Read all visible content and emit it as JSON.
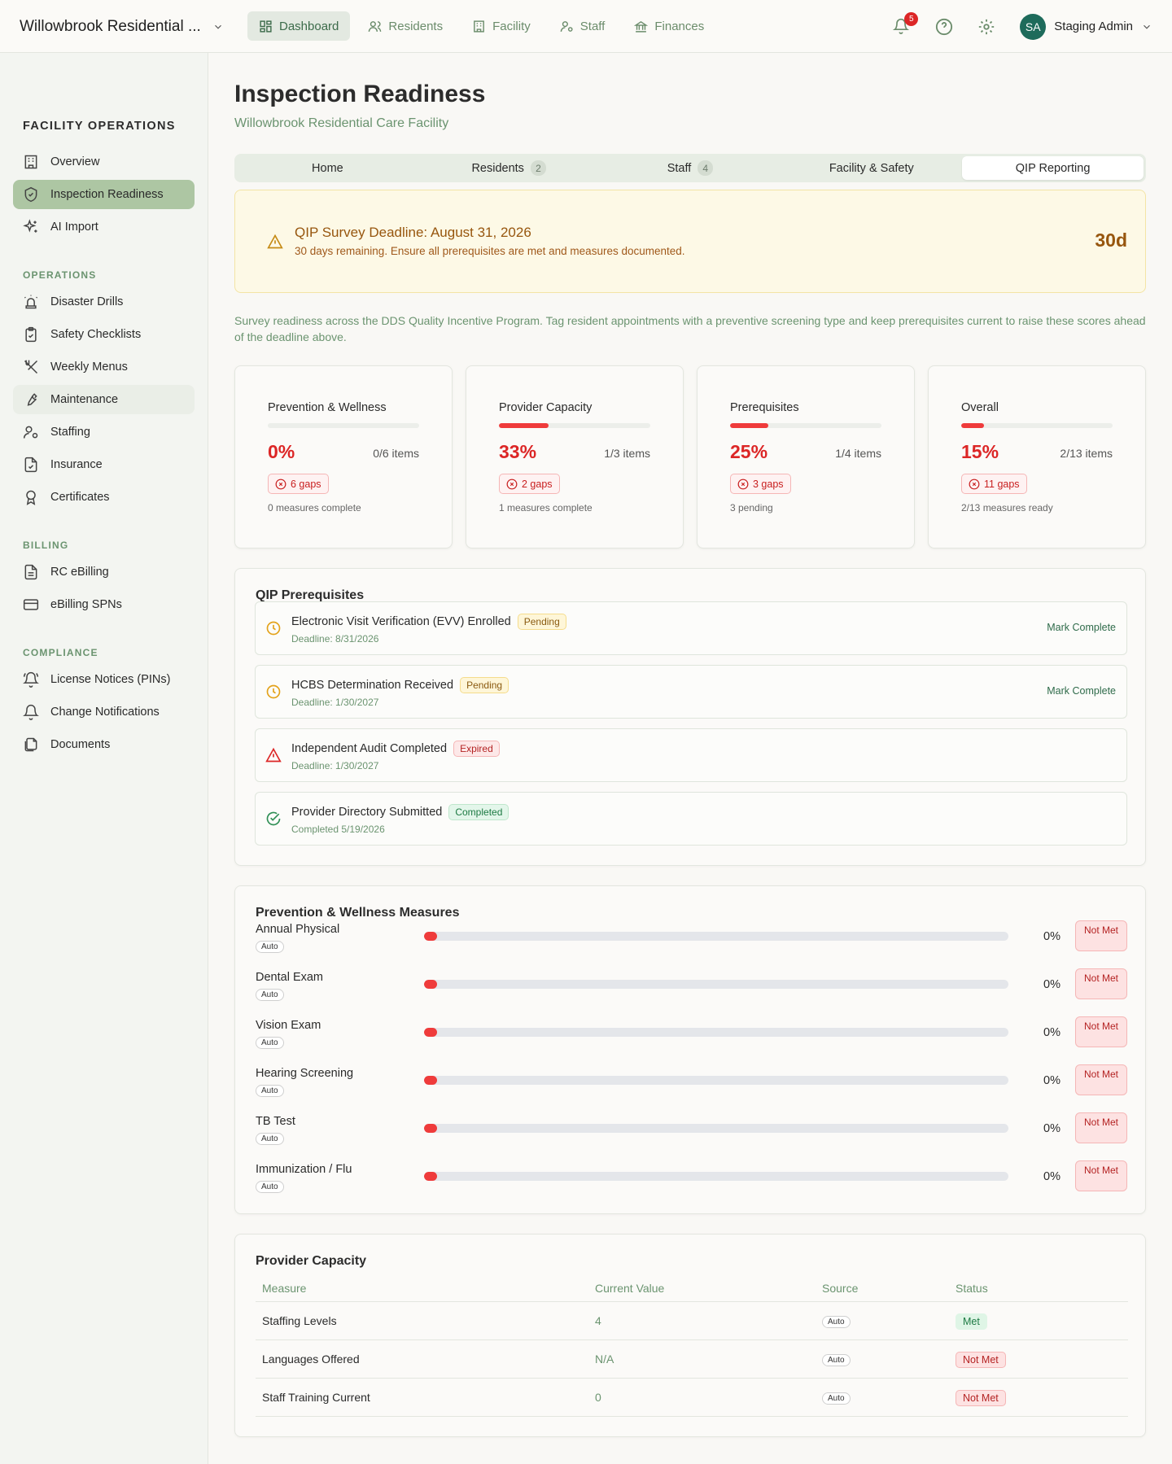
{
  "header": {
    "facility_name": "Willowbrook Residential ...",
    "nav": [
      {
        "label": "Dashboard",
        "icon": "dashboard-icon"
      },
      {
        "label": "Residents",
        "icon": "users-icon"
      },
      {
        "label": "Facility",
        "icon": "building-icon"
      },
      {
        "label": "Staff",
        "icon": "staff-icon"
      },
      {
        "label": "Finances",
        "icon": "bank-icon"
      }
    ],
    "notification_count": "5",
    "user_initials": "SA",
    "user_name": "Staging Admin"
  },
  "sidebar": {
    "title": "FACILITY OPERATIONS",
    "top_items": [
      {
        "label": "Overview"
      },
      {
        "label": "Inspection Readiness"
      },
      {
        "label": "AI Import"
      }
    ],
    "sections": [
      {
        "title": "OPERATIONS",
        "items": [
          {
            "label": "Disaster Drills"
          },
          {
            "label": "Safety Checklists"
          },
          {
            "label": "Weekly Menus"
          },
          {
            "label": "Maintenance"
          },
          {
            "label": "Staffing"
          },
          {
            "label": "Insurance"
          },
          {
            "label": "Certificates"
          }
        ]
      },
      {
        "title": "BILLING",
        "items": [
          {
            "label": "RC eBilling"
          },
          {
            "label": "eBilling SPNs"
          }
        ]
      },
      {
        "title": "COMPLIANCE",
        "items": [
          {
            "label": "License Notices (PINs)"
          },
          {
            "label": "Change Notifications"
          },
          {
            "label": "Documents"
          }
        ]
      }
    ]
  },
  "page": {
    "title": "Inspection Readiness",
    "subtitle": "Willowbrook Residential Care Facility",
    "tabs": [
      {
        "label": "Home",
        "count": ""
      },
      {
        "label": "Residents",
        "count": "2"
      },
      {
        "label": "Staff",
        "count": "4"
      },
      {
        "label": "Facility & Safety",
        "count": ""
      },
      {
        "label": "QIP Reporting",
        "count": ""
      }
    ],
    "active_tab": "QIP Reporting",
    "alert": {
      "title": "QIP Survey Deadline: August 31, 2026",
      "detail": "30 days remaining. Ensure all prerequisites are met and measures documented.",
      "days": "30d"
    },
    "intro": "Survey readiness across the DDS Quality Incentive Program. Tag resident appointments with a preventive screening type and keep prerequisites current to raise these scores ahead of the deadline above."
  },
  "kpis": [
    {
      "label": "Prevention & Wellness",
      "percent": "0%",
      "progress": 0,
      "items": "0/6 items",
      "gaps": "6 gaps",
      "footer": "0 measures complete"
    },
    {
      "label": "Provider Capacity",
      "percent": "33%",
      "progress": 0.33,
      "items": "1/3 items",
      "gaps": "2 gaps",
      "footer": "1 measures complete"
    },
    {
      "label": "Prerequisites",
      "percent": "25%",
      "progress": 0.25,
      "items": "1/4 items",
      "gaps": "3 gaps",
      "footer": "3 pending"
    },
    {
      "label": "Overall",
      "percent": "15%",
      "progress": 0.15,
      "items": "2/13 items",
      "gaps": "11 gaps",
      "footer": "2/13 measures ready"
    }
  ],
  "prerequisites": {
    "title": "QIP Prerequisites",
    "items": [
      {
        "name": "Electronic Visit Verification (EVV) Enrolled",
        "status": "Pending",
        "date": "Deadline: 8/31/2026",
        "action": "Mark Complete"
      },
      {
        "name": "HCBS Determination Received",
        "status": "Pending",
        "date": "Deadline: 1/30/2027",
        "action": "Mark Complete"
      },
      {
        "name": "Independent Audit Completed",
        "status": "Expired",
        "date": "Deadline: 1/30/2027",
        "action": ""
      },
      {
        "name": "Provider Directory Submitted",
        "status": "Completed",
        "date": "Completed 5/19/2026",
        "action": ""
      }
    ]
  },
  "wellness": {
    "title": "Prevention & Wellness Measures",
    "items": [
      {
        "name": "Annual Physical",
        "source": "Auto",
        "percent": "0%",
        "status": "Not Met"
      },
      {
        "name": "Dental Exam",
        "source": "Auto",
        "percent": "0%",
        "status": "Not Met"
      },
      {
        "name": "Vision Exam",
        "source": "Auto",
        "percent": "0%",
        "status": "Not Met"
      },
      {
        "name": "Hearing Screening",
        "source": "Auto",
        "percent": "0%",
        "status": "Not Met"
      },
      {
        "name": "TB Test",
        "source": "Auto",
        "percent": "0%",
        "status": "Not Met"
      },
      {
        "name": "Immunization / Flu",
        "source": "Auto",
        "percent": "0%",
        "status": "Not Met"
      }
    ]
  },
  "capacity": {
    "title": "Provider Capacity",
    "columns": [
      "Measure",
      "Current Value",
      "Source",
      "Status"
    ],
    "rows": [
      {
        "measure": "Staffing Levels",
        "value": "4",
        "source": "Auto",
        "status": "Met"
      },
      {
        "measure": "Languages Offered",
        "value": "N/A",
        "source": "Auto",
        "status": "Not Met"
      },
      {
        "measure": "Staff Training Current",
        "value": "0",
        "source": "Auto",
        "status": "Not Met"
      }
    ]
  }
}
